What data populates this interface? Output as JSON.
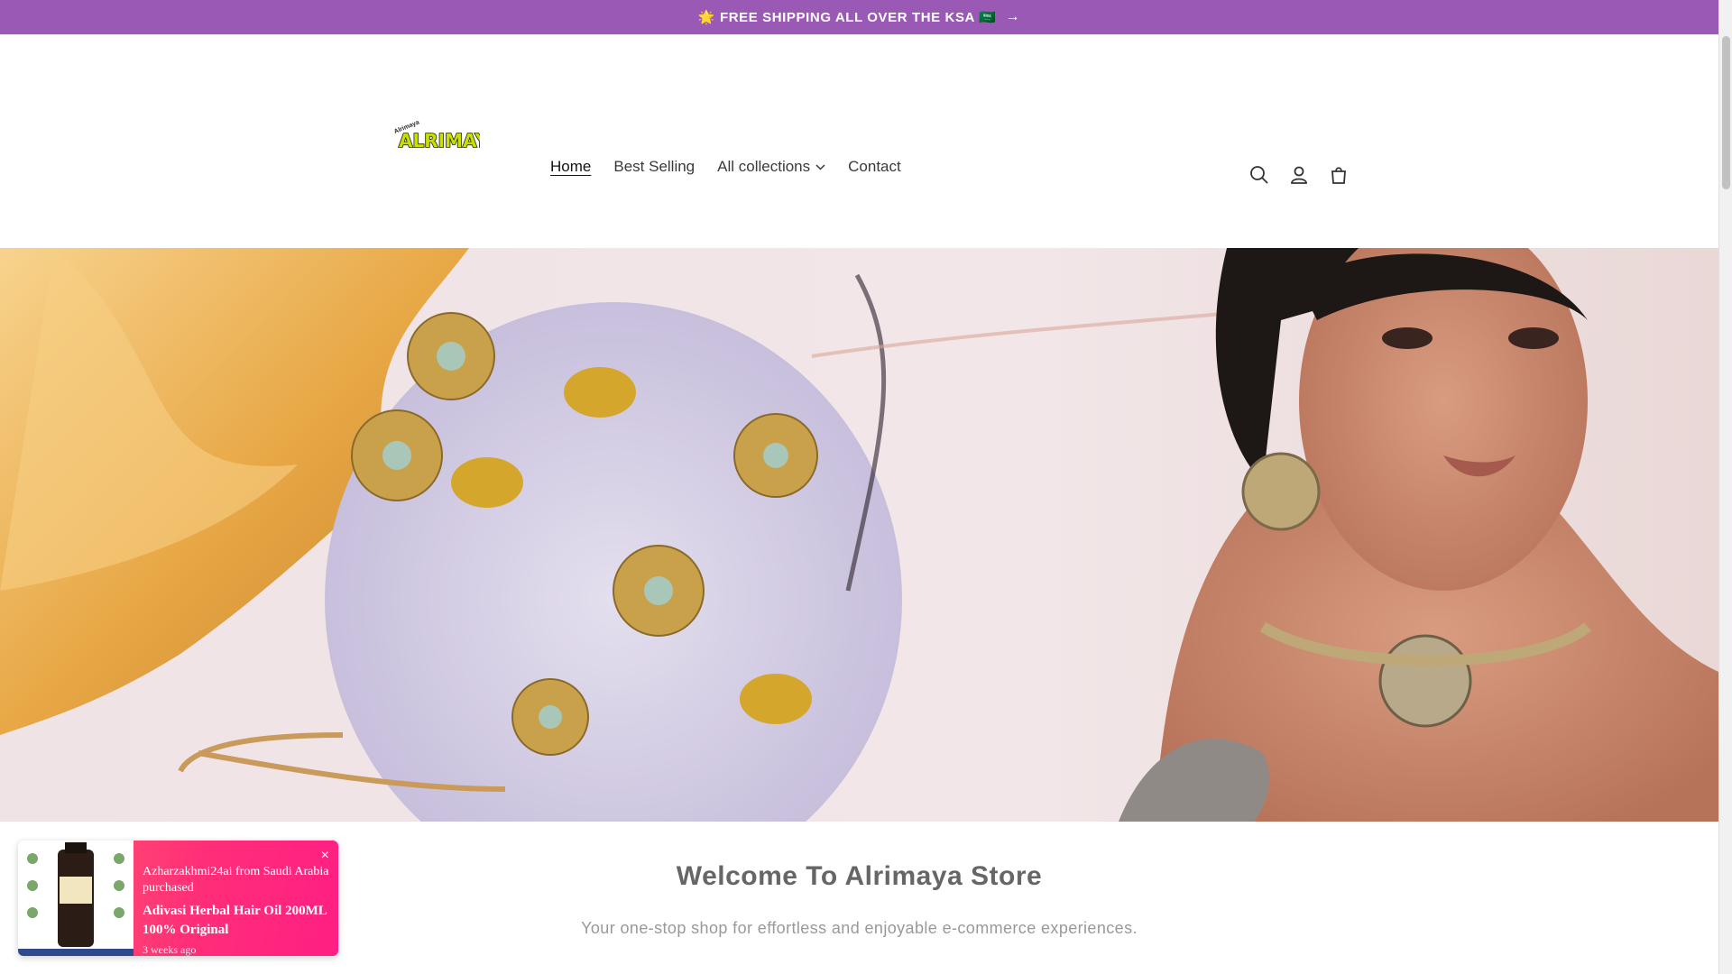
{
  "announcement": {
    "text": "🌟 FREE SHIPPING ALL OVER THE KSA 🇸🇦",
    "arrow": "→"
  },
  "brand": {
    "logo_text": "ALRIMAYA",
    "logo_subtext": "Alrimaya"
  },
  "nav": {
    "items": [
      {
        "label": "Home"
      },
      {
        "label": "Best Selling"
      },
      {
        "label": "All collections"
      },
      {
        "label": "Contact"
      }
    ]
  },
  "header_icons": [
    "search-icon",
    "account-icon",
    "cart-icon"
  ],
  "welcome": {
    "title": "Welcome To Alrimaya Store",
    "subtitle": "Your one-stop shop for effortless and enjoyable e-commerce experiences."
  },
  "popup": {
    "buyer": "Azharzakhmi24ai from Saudi Arabia purchased",
    "product": "Adivasi Herbal Hair Oil 200ML 100% Original",
    "time": "3 weeks ago",
    "close": "×"
  },
  "colors": {
    "announcement_bg": "#9b59b6",
    "popup_gradient_start": "#ff5f6d",
    "popup_gradient_end": "#ff1f84"
  }
}
